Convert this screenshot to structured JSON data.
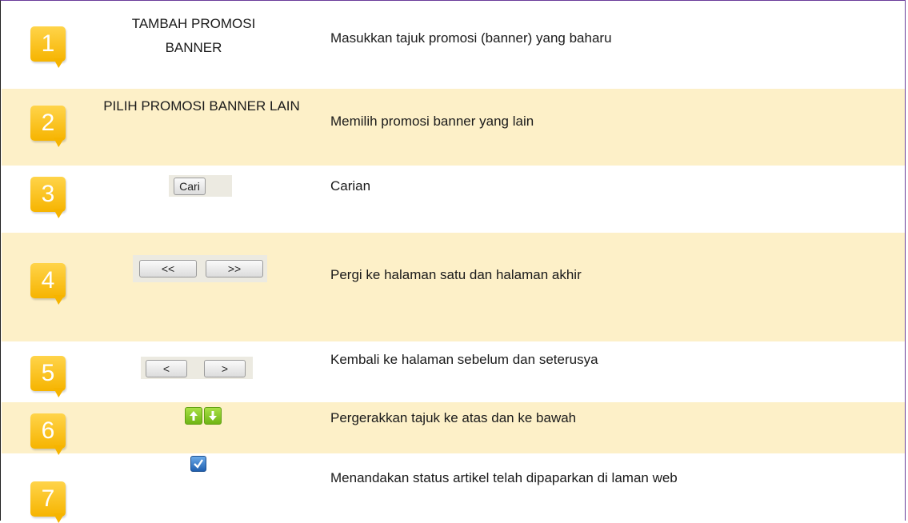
{
  "rows": [
    {
      "number": "1",
      "label": "TAMBAH PROMOSI BANNER",
      "description": "Masukkan tajuk promosi (banner) yang baharu"
    },
    {
      "number": "2",
      "label": "PILIH PROMOSI BANNER LAIN",
      "description": "Memilih promosi banner yang lain"
    },
    {
      "number": "3",
      "button": "Cari",
      "description": "Carian"
    },
    {
      "number": "4",
      "buttons": [
        "<<",
        ">>"
      ],
      "description": "Pergi ke halaman satu dan halaman akhir"
    },
    {
      "number": "5",
      "buttons": [
        "<",
        ">"
      ],
      "description": "Kembali ke halaman sebelum dan seterusya"
    },
    {
      "number": "6",
      "icons": [
        "arrow-up-icon",
        "arrow-down-icon"
      ],
      "description": "Pergerakkan tajuk ke atas dan ke bawah"
    },
    {
      "number": "7",
      "icons": [
        "checkmark-icon"
      ],
      "description": "Menandakan status artikel telah dipaparkan di laman web"
    }
  ],
  "colors": {
    "shade": "#fdf0c8",
    "badge": "#f6b400",
    "arrow_green": "#7cc21b",
    "check_blue": "#2a6fc0",
    "frame": "#6a3d9a"
  }
}
